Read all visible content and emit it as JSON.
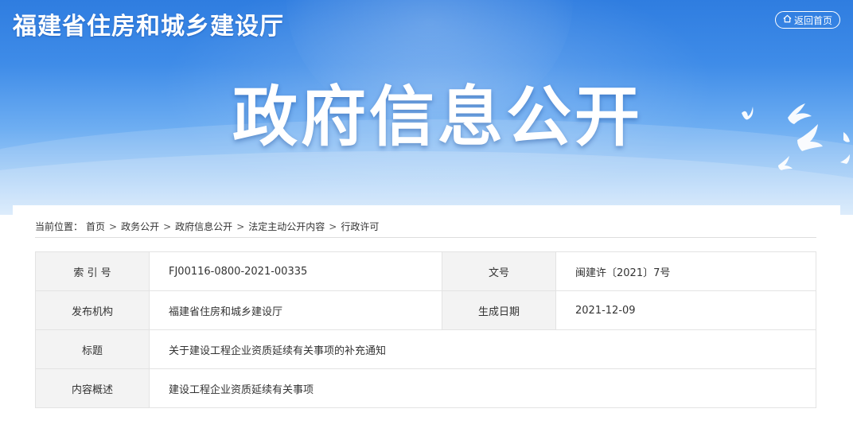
{
  "header": {
    "site_title": "福建省住房和城乡建设厅",
    "back_label": "返回首页",
    "banner_title": "政府信息公开"
  },
  "breadcrumb": {
    "prefix": "当前位置：",
    "items": [
      "首页",
      "政务公开",
      "政府信息公开",
      "法定主动公开内容",
      "行政许可"
    ],
    "separator": ">"
  },
  "info_table": {
    "index_label": "索 引 号",
    "index_value": "FJ00116-0800-2021-00335",
    "doc_no_label": "文号",
    "doc_no_value": "闽建许〔2021〕7号",
    "publisher_label": "发布机构",
    "publisher_value": "福建省住房和城乡建设厅",
    "date_label": "生成日期",
    "date_value": "2021-12-09",
    "title_label": "标题",
    "title_value": "关于建设工程企业资质延续有关事项的补充通知",
    "summary_label": "内容概述",
    "summary_value": "建设工程企业资质延续有关事项"
  },
  "icons": {
    "home": "home-icon",
    "doves": "dove-icon"
  },
  "colors": {
    "banner_top": "#2f7de0",
    "banner_bottom": "#cfe5fb",
    "label_bg": "#f3f3f3"
  }
}
